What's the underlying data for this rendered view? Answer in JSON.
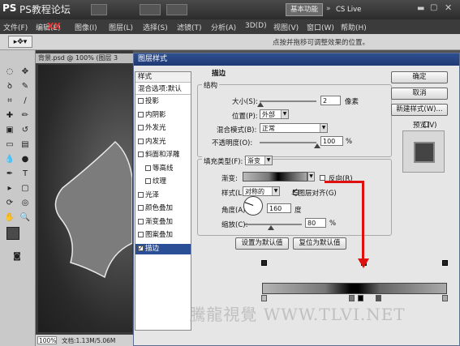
{
  "app": {
    "ps_label": "PS",
    "title_watermark": "PS教程论坛",
    "workspace_button": "基本功能",
    "cs_live": "CS Live",
    "site_watermark_top": "XX",
    "zoom_label": "100%"
  },
  "menu": [
    "文件(F)",
    "编辑(E)",
    "图像(I)",
    "图层(L)",
    "选择(S)",
    "滤镜(T)",
    "分析(A)",
    "3D(D)",
    "视图(V)",
    "窗口(W)",
    "帮助(H)"
  ],
  "options_bar": {
    "hint": "点按并拖移可调整效果的位置。"
  },
  "document": {
    "tab_title": "背景.psd @ 100% (图层 3",
    "status_zoom": "100%",
    "status_doc": "文档:1.13M/5.06M"
  },
  "dialog": {
    "title": "图层样式",
    "styles_header": "样式",
    "blend_options": "混合选项:默认",
    "style_items": [
      {
        "label": "投影",
        "checked": false,
        "indent": false
      },
      {
        "label": "内阴影",
        "checked": false,
        "indent": false
      },
      {
        "label": "外发光",
        "checked": false,
        "indent": false
      },
      {
        "label": "内发光",
        "checked": false,
        "indent": false
      },
      {
        "label": "斜面和浮雕",
        "checked": false,
        "indent": false
      },
      {
        "label": "等高线",
        "checked": false,
        "indent": true
      },
      {
        "label": "纹理",
        "checked": false,
        "indent": true
      },
      {
        "label": "光泽",
        "checked": false,
        "indent": false
      },
      {
        "label": "颜色叠加",
        "checked": false,
        "indent": false
      },
      {
        "label": "渐变叠加",
        "checked": false,
        "indent": false
      },
      {
        "label": "图案叠加",
        "checked": false,
        "indent": false
      },
      {
        "label": "描边",
        "checked": true,
        "indent": false
      }
    ],
    "stroke": {
      "section_title": "描边",
      "structure_title": "结构",
      "size_label": "大小(S):",
      "size_value": "2",
      "size_unit": "像素",
      "position_label": "位置(P):",
      "position_value": "外部",
      "blend_label": "混合模式(B):",
      "blend_value": "正常",
      "opacity_label": "不透明度(O):",
      "opacity_value": "100",
      "opacity_unit": "%",
      "fill_type_label": "填充类型(F):",
      "fill_type_value": "渐变",
      "gradient_label": "渐变:",
      "reverse_label": "反向(R)",
      "style_label": "样式(L):",
      "style_value": "对称的",
      "align_label": "与图层对齐(G)",
      "angle_label": "角度(A):",
      "angle_value": "160",
      "angle_unit": "度",
      "scale_label": "缩放(C):",
      "scale_value": "80",
      "scale_unit": "%"
    },
    "buttons": {
      "ok": "确定",
      "cancel": "取消",
      "new_style": "新建样式(W)...",
      "preview": "预览(V)",
      "set_default": "设置为默认值",
      "reset_default": "复位为默认值"
    },
    "watermark": "騰龍視覺 WWW.TLVI.NET"
  },
  "colors": {
    "arrow": "#e01010",
    "titlebar": "#2f4f8f"
  }
}
